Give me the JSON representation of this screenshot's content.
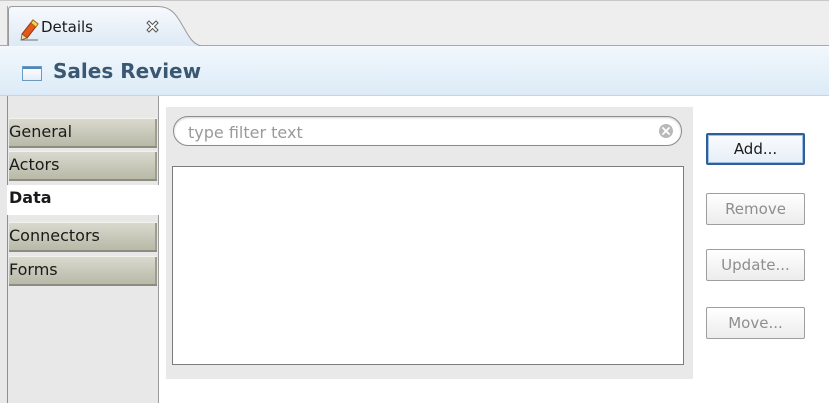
{
  "tab": {
    "title": "Details",
    "icon": "pencil-icon",
    "close_icon": "close-x-icon"
  },
  "header": {
    "title": "Sales Review",
    "icon": "window-icon"
  },
  "sidebar": {
    "items": [
      {
        "label": "General",
        "active": false
      },
      {
        "label": "Actors",
        "active": false
      },
      {
        "label": "Data",
        "active": true
      },
      {
        "label": "Connectors",
        "active": false
      },
      {
        "label": "Forms",
        "active": false
      }
    ]
  },
  "filter": {
    "placeholder": "type filter text",
    "value": ""
  },
  "buttons": {
    "add": "Add...",
    "remove": "Remove",
    "update": "Update...",
    "move": "Move..."
  },
  "colors": {
    "accent": "#2f5f96",
    "header_title": "#3b5873"
  }
}
